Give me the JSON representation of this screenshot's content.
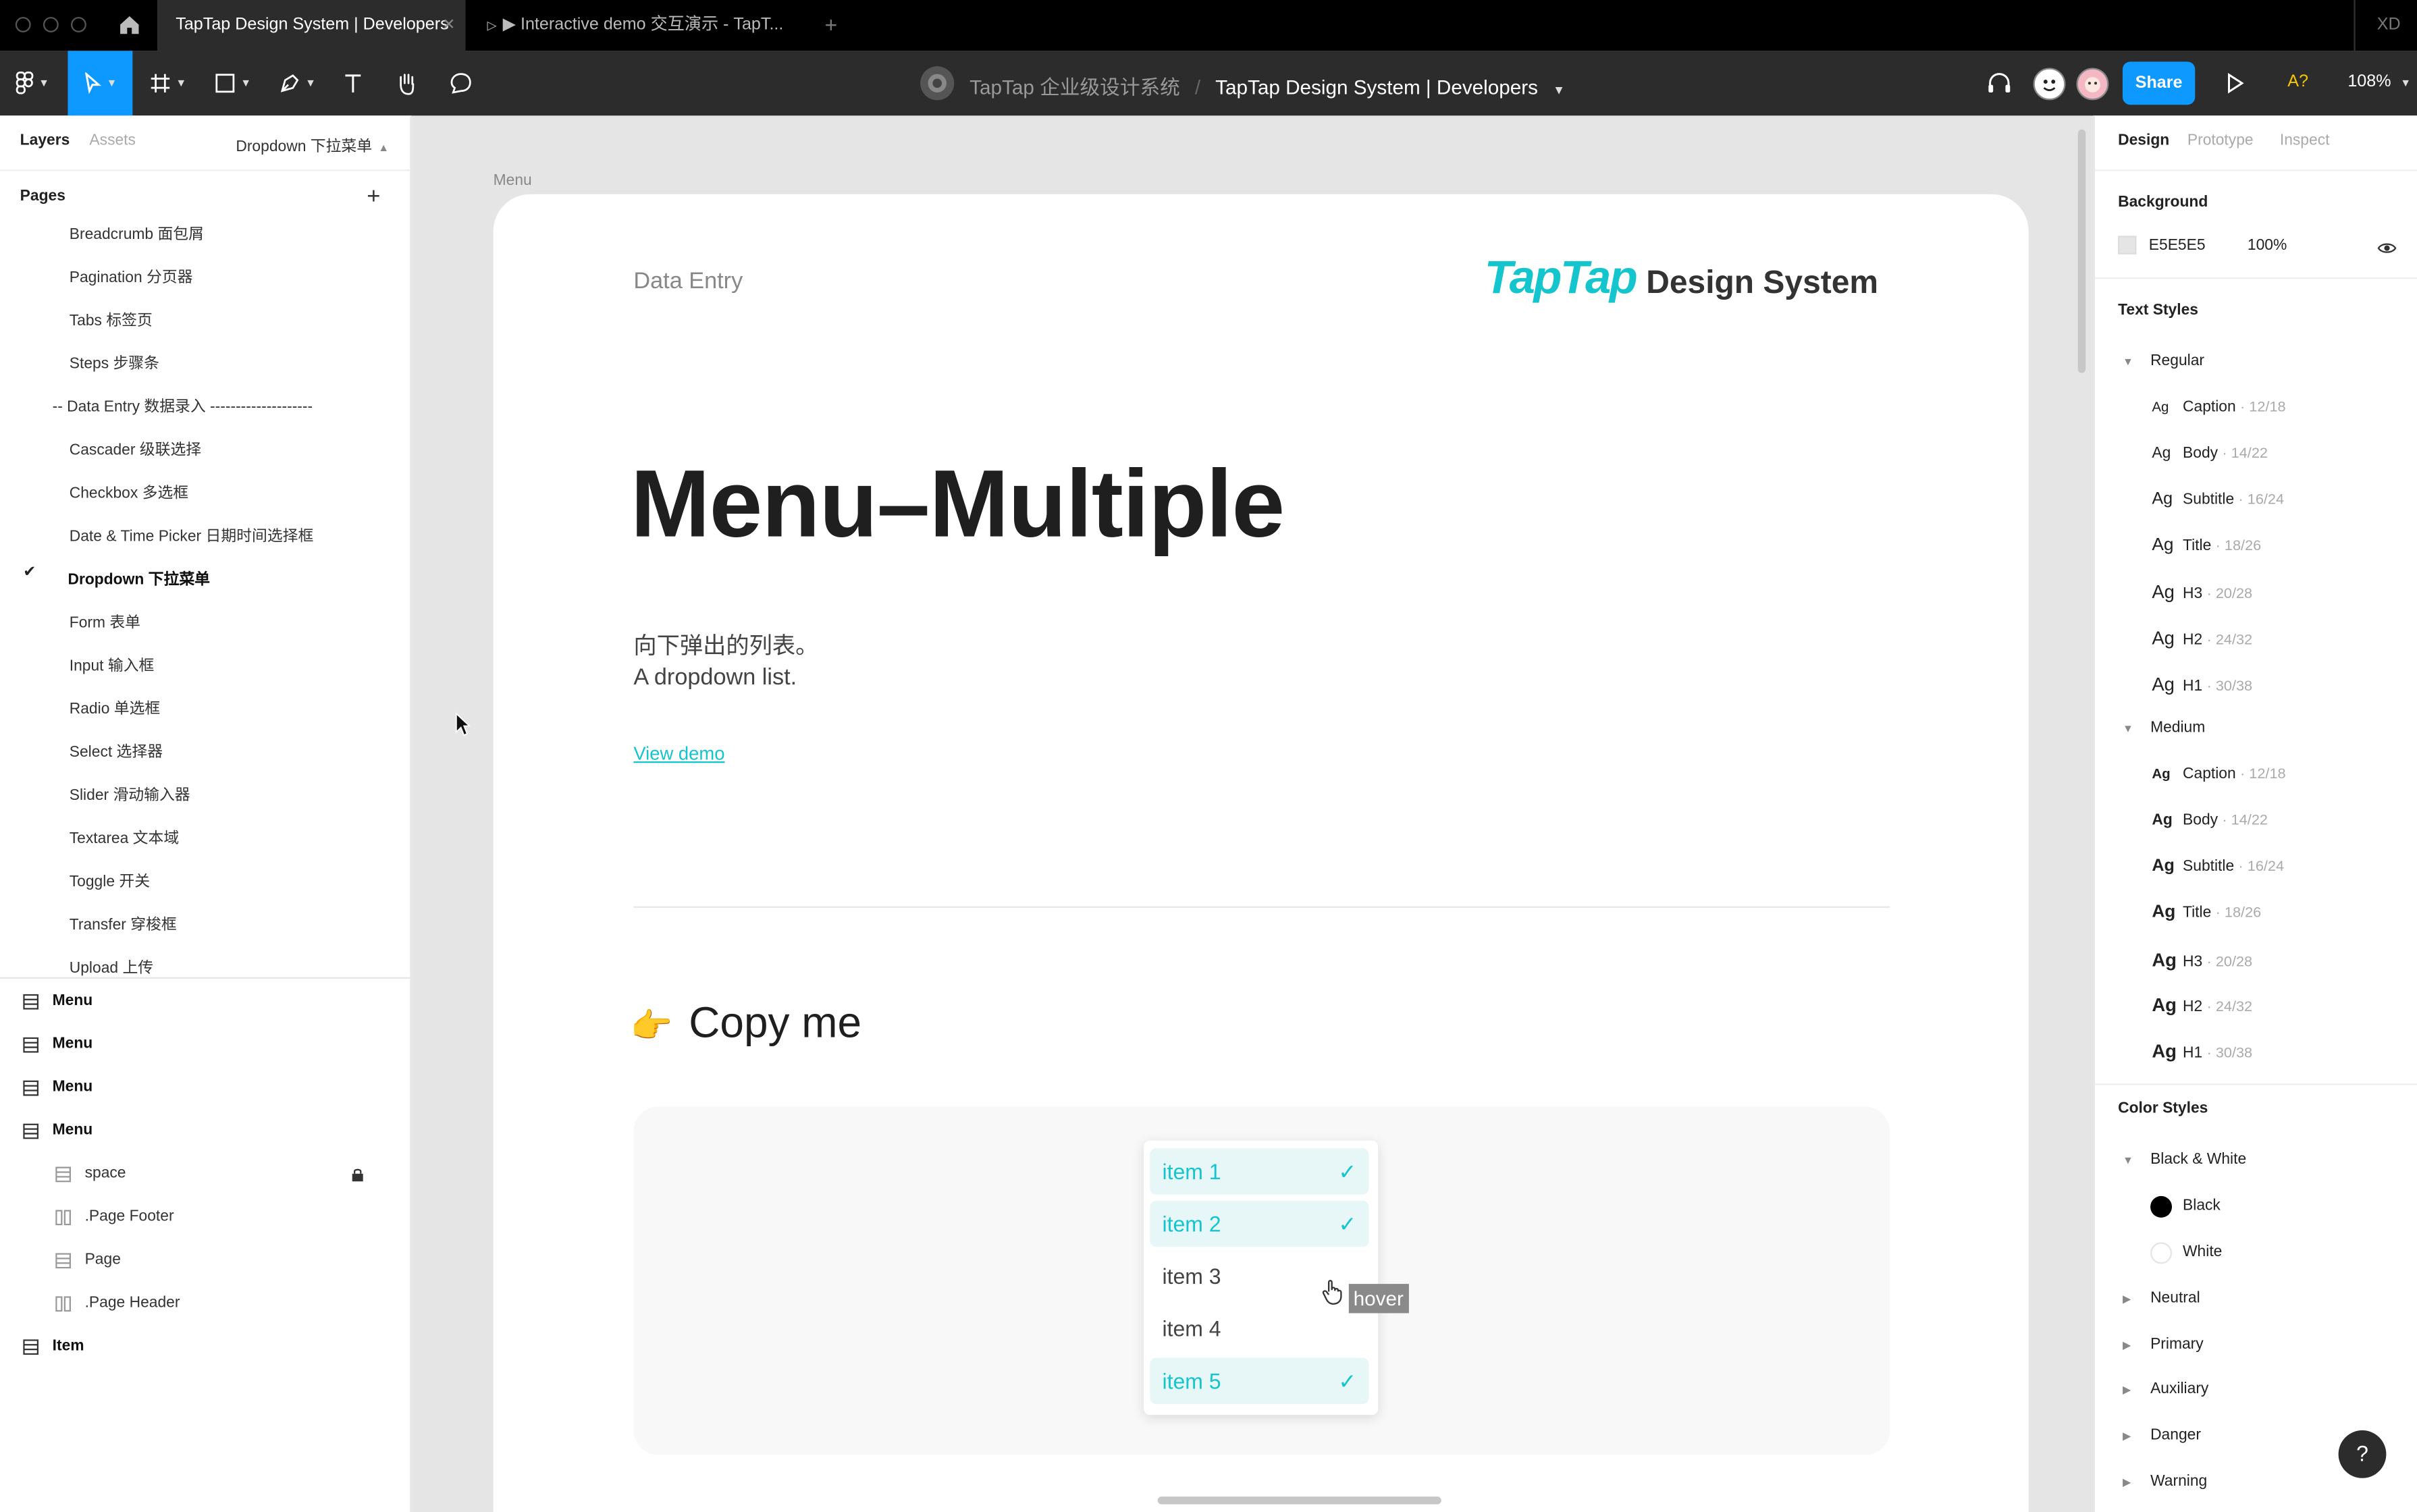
{
  "tabs": {
    "home_icon": "home-icon",
    "active": "TapTap Design System | Developers",
    "inactive": "▶ Interactive demo 交互演示 - TapT...",
    "add": "+",
    "right_label": "XD"
  },
  "toolbar": {
    "breadcrumb_team": "TapTap 企业级设计系统",
    "breadcrumb_sep": "/",
    "breadcrumb_file": "TapTap Design System | Developers",
    "share": "Share",
    "font_warning": "A?",
    "zoom": "108%"
  },
  "left": {
    "tab_layers": "Layers",
    "tab_assets": "Assets",
    "page_selector": "Dropdown 下拉菜单",
    "pages_title": "Pages",
    "pages": [
      "Breadcrumb 面包屑",
      "Pagination 分页器",
      "Tabs 标签页",
      "Steps 步骤条",
      "-- Data Entry 数据录入 --------------------",
      "Cascader 级联选择",
      "Checkbox 多选框",
      "Date & Time Picker 日期时间选择框",
      "Dropdown 下拉菜单",
      "Form 表单",
      "Input 输入框",
      "Radio 单选框",
      "Select 选择器",
      "Slider 滑动输入器",
      "Textarea 文本域",
      "Toggle 开关",
      "Transfer 穿梭框",
      "Upload 上传"
    ],
    "layers": [
      "Menu",
      "Menu",
      "Menu",
      "Menu",
      "space",
      ".Page Footer",
      "Page",
      ".Page Header",
      "Item"
    ]
  },
  "right": {
    "tab_design": "Design",
    "tab_prototype": "Prototype",
    "tab_inspect": "Inspect",
    "background_title": "Background",
    "bg_hex": "E5E5E5",
    "bg_opacity": "100%",
    "bg_color": "#e5e5e5",
    "text_styles_title": "Text Styles",
    "ag": "Ag",
    "regular_title": "Regular",
    "regular": [
      {
        "name": "Caption",
        "spec": "· 12/18"
      },
      {
        "name": "Body",
        "spec": "· 14/22"
      },
      {
        "name": "Subtitle",
        "spec": "· 16/24"
      },
      {
        "name": "Title",
        "spec": "· 18/26"
      },
      {
        "name": "H3",
        "spec": "· 20/28"
      },
      {
        "name": "H2",
        "spec": "· 24/32"
      },
      {
        "name": "H1",
        "spec": "· 30/38"
      }
    ],
    "medium_title": "Medium",
    "medium": [
      {
        "name": "Caption",
        "spec": "· 12/18"
      },
      {
        "name": "Body",
        "spec": "· 14/22"
      },
      {
        "name": "Subtitle",
        "spec": "· 16/24"
      },
      {
        "name": "Title",
        "spec": "· 18/26"
      },
      {
        "name": "H3",
        "spec": "· 20/28"
      },
      {
        "name": "H2",
        "spec": "· 24/32"
      },
      {
        "name": "H1",
        "spec": "· 30/38"
      }
    ],
    "color_styles_title": "Color Styles",
    "bw_title": "Black & White",
    "black": "Black",
    "white": "White",
    "color_groups": [
      "Neutral",
      "Primary",
      "Auxiliary",
      "Danger",
      "Warning"
    ],
    "help": "?"
  },
  "canvas": {
    "frame_label": "Menu",
    "section": "Data Entry",
    "logo_taptap": "TapTap",
    "logo_ds": "Design System",
    "title": "Menu–Multiple",
    "desc_cn": "向下弹出的列表。",
    "desc_en": "A dropdown list.",
    "view_demo": "View demo",
    "copy_emoji": "👉",
    "copy_me": "Copy me",
    "menu_items": [
      {
        "label": "item 1",
        "selected": true
      },
      {
        "label": "item 2",
        "selected": true
      },
      {
        "label": "item 3",
        "selected": false
      },
      {
        "label": "item 4",
        "selected": false
      },
      {
        "label": "item 5",
        "selected": true
      }
    ],
    "check": "✓",
    "hover_tag": "hover"
  },
  "colors": {
    "brand": "#15c5ce",
    "figma_blue": "#0d99ff",
    "topbar": "#000000",
    "toolbar": "#2c2c2c"
  }
}
